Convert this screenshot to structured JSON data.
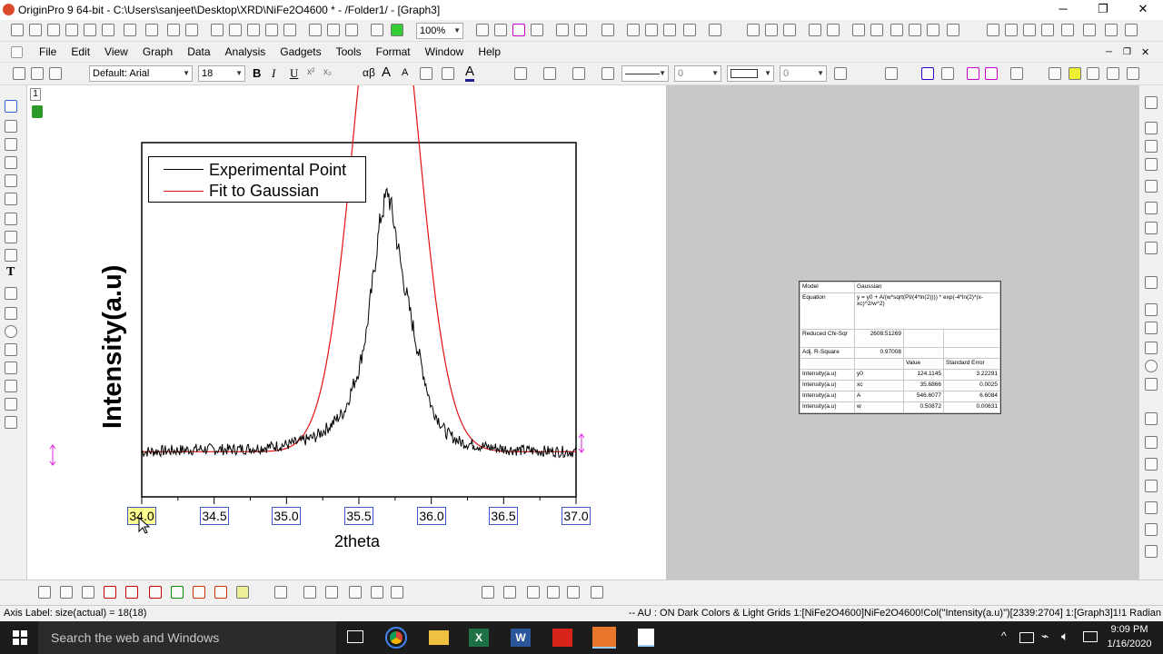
{
  "window": {
    "title": "OriginPro 9 64-bit - C:\\Users\\sanjeet\\Desktop\\XRD\\NiFe2O4600 * - /Folder1/ - [Graph3]",
    "minimize": "─",
    "maximize": "❐",
    "close": "✕"
  },
  "toolbar1": {
    "zoom": "100%"
  },
  "menu": [
    "File",
    "Edit",
    "View",
    "Graph",
    "Data",
    "Analysis",
    "Gadgets",
    "Tools",
    "Format",
    "Window",
    "Help"
  ],
  "format_toolbar": {
    "font": "Default: Arial",
    "size": "18",
    "bold": "B",
    "italic": "I",
    "underline": "U",
    "sup": "x²",
    "sub": "x₂",
    "greek": "αβ",
    "grow": "A",
    "shrink": "A",
    "color_val1": "0",
    "color_val2": "0"
  },
  "layer": {
    "number": "1"
  },
  "graph": {
    "legend": [
      {
        "label": "Experimental Point",
        "color": "#000000"
      },
      {
        "label": "Fit to Gaussian",
        "color": "#e01010"
      }
    ]
  },
  "chart_data": {
    "type": "line",
    "xlabel": "2theta",
    "ylabel": "Intensity(a.u)",
    "xlim": [
      34.0,
      37.0
    ],
    "xticks": [
      "34.0",
      "34.5",
      "35.0",
      "35.5",
      "36.0",
      "36.5",
      "37.0"
    ],
    "grid": false,
    "legend_position": "top-left",
    "fit": {
      "model": "Gaussian",
      "y0": 124.1145,
      "xc": 35.6866,
      "A": 546.6077,
      "w": 0.50872
    },
    "series": [
      {
        "name": "Experimental Point",
        "color": "#000000",
        "x": [
          34.0,
          34.2,
          34.4,
          34.6,
          34.8,
          35.0,
          35.1,
          35.2,
          35.3,
          35.4,
          35.5,
          35.55,
          35.6,
          35.65,
          35.7,
          35.75,
          35.8,
          35.9,
          36.0,
          36.1,
          36.2,
          36.4,
          36.6,
          36.8,
          37.0
        ],
        "values": [
          124,
          126,
          129,
          128,
          131,
          137,
          143,
          152,
          172,
          200,
          278,
          345,
          450,
          560,
          610,
          540,
          455,
          322,
          208,
          160,
          142,
          132,
          127,
          125,
          124
        ]
      },
      {
        "name": "Fit to Gaussian",
        "color": "#e01010"
      }
    ]
  },
  "fit_table": {
    "model_label": "Model",
    "model_value": "Gaussian",
    "equation_label": "Equation",
    "equation_value": "y = y0 + A/(w*sqrt(PI/(4*ln(2)))) * exp(-4*ln(2)*(x-xc)^2/w^2)",
    "chisq_label": "Reduced Chi-Sqr",
    "chisq_value": "2608.51269",
    "r2_label": "Adj. R-Square",
    "r2_value": "0.97008",
    "col_value": "Value",
    "col_err": "Standard Error",
    "params": [
      {
        "dep": "Intensity(a.u)",
        "name": "y0",
        "value": "124.1145",
        "err": "3.22291"
      },
      {
        "dep": "Intensity(a.u)",
        "name": "xc",
        "value": "35.6866",
        "err": "0.0025"
      },
      {
        "dep": "Intensity(a.u)",
        "name": "A",
        "value": "546.6077",
        "err": "6.6084"
      },
      {
        "dep": "Intensity(a.u)",
        "name": "w",
        "value": "0.50872",
        "err": "0.00631"
      }
    ]
  },
  "status": {
    "left": "Axis Label: size(actual) = 18(18)",
    "right": "-- AU : ON  Dark Colors & Light Grids  1:[NiFe2O4600]NiFe2O4600!Col(\"Intensity(a.u)\")[2339:2704]  1:[Graph3]1!1  Radian"
  },
  "taskbar": {
    "search": "Search the web and Windows",
    "time": "9:09 PM",
    "date": "1/16/2020"
  }
}
